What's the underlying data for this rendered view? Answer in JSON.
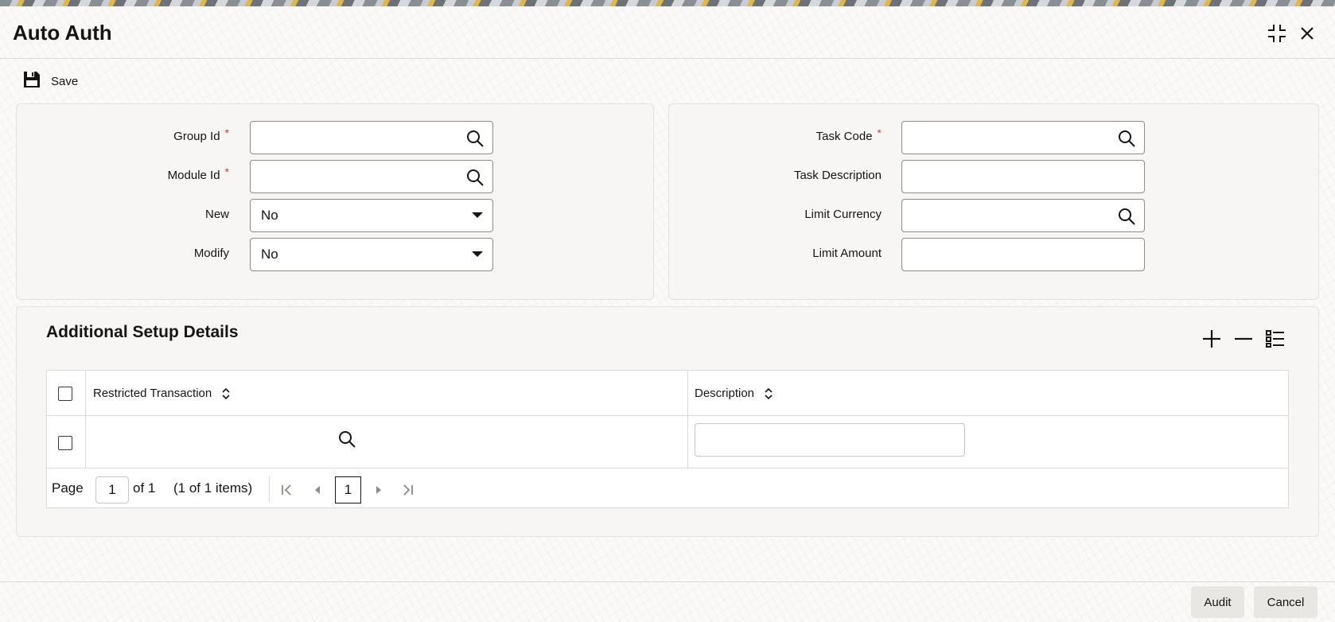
{
  "window": {
    "title": "Auto Auth"
  },
  "toolbar": {
    "save_label": "Save"
  },
  "left_form": {
    "group_id": {
      "label": "Group Id",
      "required_mark": "*",
      "value": ""
    },
    "module_id": {
      "label": "Module Id",
      "required_mark": "*",
      "value": ""
    },
    "new": {
      "label": "New",
      "value": "No"
    },
    "modify": {
      "label": "Modify",
      "value": "No"
    }
  },
  "right_form": {
    "task_code": {
      "label": "Task Code",
      "required_mark": "*",
      "value": ""
    },
    "task_description": {
      "label": "Task Description",
      "value": ""
    },
    "limit_currency": {
      "label": "Limit Currency",
      "value": ""
    },
    "limit_amount": {
      "label": "Limit Amount",
      "value": ""
    }
  },
  "additional": {
    "title": "Additional Setup Details",
    "columns": [
      "Restricted Transaction",
      "Description"
    ],
    "rows": [
      {
        "restricted_transaction": "",
        "description": ""
      }
    ],
    "pager": {
      "page_label": "Page",
      "page_value": "1",
      "of_label": "of 1",
      "items_label": "(1 of 1 items)",
      "current_page": "1"
    }
  },
  "footer": {
    "audit_label": "Audit",
    "cancel_label": "Cancel"
  },
  "icons": {
    "save": "floppy-disk-icon",
    "search": "magnifier-icon",
    "dropdown": "caret-down-icon",
    "add": "plus-icon",
    "remove": "minus-icon",
    "columns": "list-icon",
    "sort": "sort-icon",
    "minimize": "collapse-icon",
    "close": "close-icon"
  },
  "colors": {
    "required": "#c74634",
    "text": "#161513",
    "button_bg": "#e9e7e4"
  }
}
